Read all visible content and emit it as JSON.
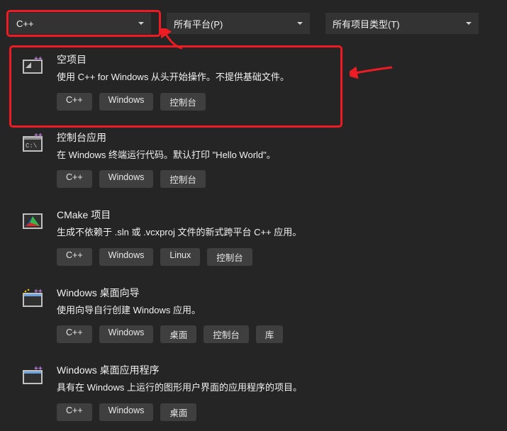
{
  "filters": {
    "language": "C++",
    "platform": "所有平台(P)",
    "projectType": "所有项目类型(T)"
  },
  "templates": [
    {
      "title": "空项目",
      "desc": "使用 C++ for Windows 从头开始操作。不提供基础文件。",
      "tags": [
        "C++",
        "Windows",
        "控制台"
      ]
    },
    {
      "title": "控制台应用",
      "desc": "在 Windows 终端运行代码。默认打印 \"Hello World\"。",
      "tags": [
        "C++",
        "Windows",
        "控制台"
      ]
    },
    {
      "title": "CMake 项目",
      "desc": "生成不依赖于 .sln 或 .vcxproj 文件的新式跨平台 C++ 应用。",
      "tags": [
        "C++",
        "Windows",
        "Linux",
        "控制台"
      ]
    },
    {
      "title": "Windows 桌面向导",
      "desc": "使用向导自行创建 Windows 应用。",
      "tags": [
        "C++",
        "Windows",
        "桌面",
        "控制台",
        "库"
      ]
    },
    {
      "title": "Windows 桌面应用程序",
      "desc": "具有在 Windows 上运行的图形用户界面的应用程序的项目。",
      "tags": [
        "C++",
        "Windows",
        "桌面"
      ]
    }
  ]
}
